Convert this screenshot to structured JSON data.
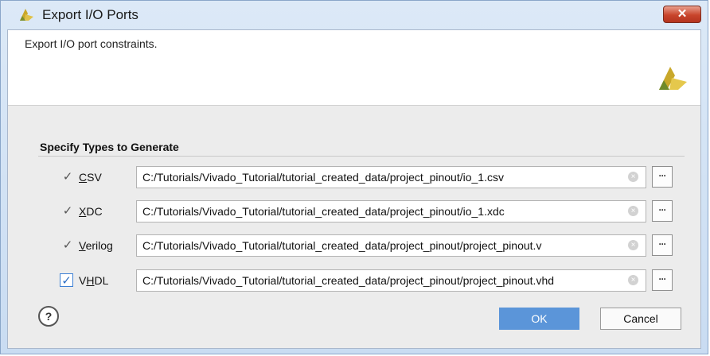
{
  "window": {
    "title": "Export I/O Ports",
    "close_label": "✕"
  },
  "banner": {
    "description": "Export I/O port constraints."
  },
  "section": {
    "title": "Specify Types to Generate"
  },
  "rows": [
    {
      "label_pre": "",
      "label_mnemonic": "C",
      "label_post": "SV",
      "checked": true,
      "path": "C:/Tutorials/Vivado_Tutorial/tutorial_created_data/project_pinout/io_1.csv"
    },
    {
      "label_pre": "",
      "label_mnemonic": "X",
      "label_post": "DC",
      "checked": true,
      "path": "C:/Tutorials/Vivado_Tutorial/tutorial_created_data/project_pinout/io_1.xdc"
    },
    {
      "label_pre": "",
      "label_mnemonic": "V",
      "label_post": "erilog",
      "checked": true,
      "path": "C:/Tutorials/Vivado_Tutorial/tutorial_created_data/project_pinout/project_pinout.v"
    },
    {
      "label_pre": "V",
      "label_mnemonic": "H",
      "label_post": "DL",
      "checked": true,
      "path": "C:/Tutorials/Vivado_Tutorial/tutorial_created_data/project_pinout/project_pinout.vhd"
    }
  ],
  "common": {
    "check_glyph": "✓",
    "clear_glyph": "×",
    "browse_label": "···"
  },
  "buttons": {
    "help_label": "?",
    "ok_label": "OK",
    "cancel_label": "Cancel"
  },
  "colors": {
    "ok_button": "#5b95d9",
    "logo": "#d9b52a"
  }
}
